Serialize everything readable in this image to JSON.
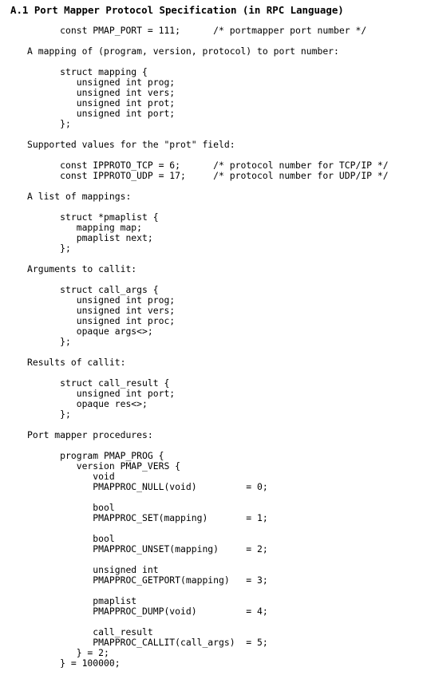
{
  "title": "A.1 Port Mapper Protocol Specification (in RPC Language)",
  "lines": [
    "      const PMAP_PORT = 111;      /* portmapper port number */",
    "",
    "A mapping of (program, version, protocol) to port number:",
    "",
    "      struct mapping {",
    "         unsigned int prog;",
    "         unsigned int vers;",
    "         unsigned int prot;",
    "         unsigned int port;",
    "      };",
    "",
    "Supported values for the \"prot\" field:",
    "",
    "      const IPPROTO_TCP = 6;      /* protocol number for TCP/IP */",
    "      const IPPROTO_UDP = 17;     /* protocol number for UDP/IP */",
    "",
    "A list of mappings:",
    "",
    "      struct *pmaplist {",
    "         mapping map;",
    "         pmaplist next;",
    "      };",
    "",
    "Arguments to callit:",
    "",
    "      struct call_args {",
    "         unsigned int prog;",
    "         unsigned int vers;",
    "         unsigned int proc;",
    "         opaque args<>;",
    "      };",
    "",
    "Results of callit:",
    "",
    "      struct call_result {",
    "         unsigned int port;",
    "         opaque res<>;",
    "      };",
    "",
    "Port mapper procedures:",
    "",
    "      program PMAP_PROG {",
    "         version PMAP_VERS {",
    "            void",
    "            PMAPPROC_NULL(void)         = 0;",
    "",
    "            bool",
    "            PMAPPROC_SET(mapping)       = 1;",
    "",
    "            bool",
    "            PMAPPROC_UNSET(mapping)     = 2;",
    "",
    "            unsigned int",
    "            PMAPPROC_GETPORT(mapping)   = 3;",
    "",
    "            pmaplist",
    "            PMAPPROC_DUMP(void)         = 4;",
    "",
    "            call_result",
    "            PMAPPROC_CALLIT(call_args)  = 5;",
    "         } = 2;",
    "      } = 100000;"
  ]
}
